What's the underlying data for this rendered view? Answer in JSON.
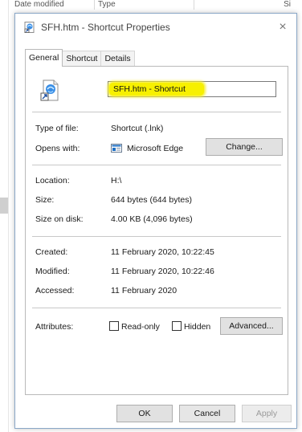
{
  "background": {
    "columns": [
      "Date modified",
      "Type",
      "Si"
    ]
  },
  "dialog": {
    "title": "SFH.htm - Shortcut Properties",
    "close_glyph": "×"
  },
  "tabs": [
    {
      "label": "General",
      "active": true
    },
    {
      "label": "Shortcut",
      "active": false
    },
    {
      "label": "Details",
      "active": false
    }
  ],
  "general": {
    "file_name": "SFH.htm - Shortcut",
    "type_label": "Type of file:",
    "type_value": "Shortcut (.lnk)",
    "opens_label": "Opens with:",
    "opens_value": "Microsoft Edge",
    "change_button": "Change...",
    "location_label": "Location:",
    "location_value": "H:\\",
    "size_label": "Size:",
    "size_value": "644 bytes (644 bytes)",
    "size_disk_label": "Size on disk:",
    "size_disk_value": "4.00 KB (4,096 bytes)",
    "created_label": "Created:",
    "created_value": "11 February 2020, 10:22:45",
    "modified_label": "Modified:",
    "modified_value": "11 February 2020, 10:22:46",
    "accessed_label": "Accessed:",
    "accessed_value": "11 February 2020",
    "attributes_label": "Attributes:",
    "readonly_label": "Read-only",
    "hidden_label": "Hidden",
    "advanced_button": "Advanced..."
  },
  "footer": {
    "ok": "OK",
    "cancel": "Cancel",
    "apply": "Apply"
  },
  "colors": {
    "highlight": "#f7f000",
    "edge_blue": "#1e6fc4"
  }
}
